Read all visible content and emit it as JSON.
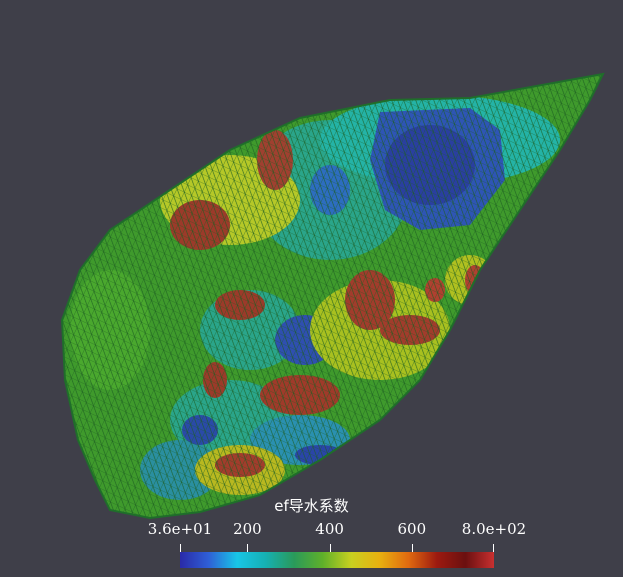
{
  "legend": {
    "title": "ef导水系数",
    "ticks": [
      {
        "label": "3.6e+01",
        "value": 36
      },
      {
        "label": "200",
        "value": 200
      },
      {
        "label": "400",
        "value": 400
      },
      {
        "label": "600",
        "value": 600
      },
      {
        "label": "8.0e+02",
        "value": 800
      }
    ],
    "range": [
      36,
      800
    ],
    "colormap": [
      "#2a2aa8",
      "#2f5fd6",
      "#18c6e6",
      "#16b0b3",
      "#2a9a5a",
      "#5fb02a",
      "#c8d020",
      "#e8b010",
      "#e06a10",
      "#9c1a10",
      "#6b1010",
      "#c83030"
    ]
  },
  "colors": {
    "background": "#3f3f49",
    "mesh": "#1f6e2a"
  }
}
